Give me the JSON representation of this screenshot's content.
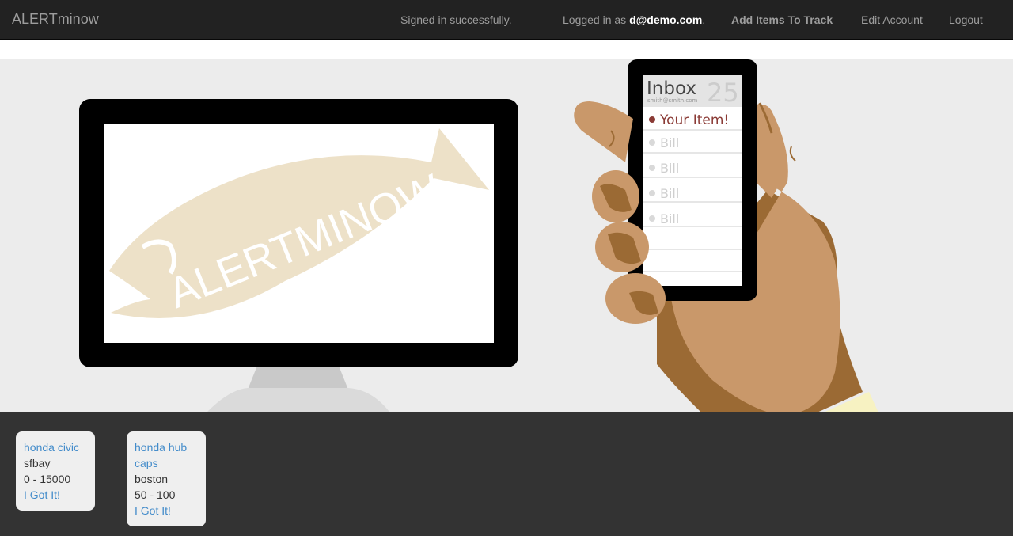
{
  "navbar": {
    "brand": "ALERTminow",
    "flash": "Signed in successfully.",
    "logged_in_prefix": "Logged in as ",
    "user_email": "d@demo.com",
    "logged_in_suffix": ".",
    "add_items": "Add Items To Track",
    "edit_account": "Edit Account",
    "logout": "Logout"
  },
  "hero": {
    "monitor_logo": "ALERTMINOW",
    "phone": {
      "inbox_title": "Inbox",
      "inbox_email": "smith@smith.com",
      "inbox_count": "25",
      "messages": [
        "Your Item!",
        "Bill",
        "Bill",
        "Bill",
        "Bill"
      ]
    },
    "colors": {
      "fish": "#ede1c8",
      "skin": "#c9986a",
      "skin_shadow": "#9b6a34",
      "sleeve": "#0a0f46",
      "cuff": "#f7f2c2"
    }
  },
  "items": [
    {
      "title": "honda civic",
      "location": "sfbay",
      "range": "0 - 15000",
      "action": "I Got It!"
    },
    {
      "title": "honda hub caps",
      "location": "boston",
      "range": "50 - 100",
      "action": "I Got It!"
    }
  ]
}
